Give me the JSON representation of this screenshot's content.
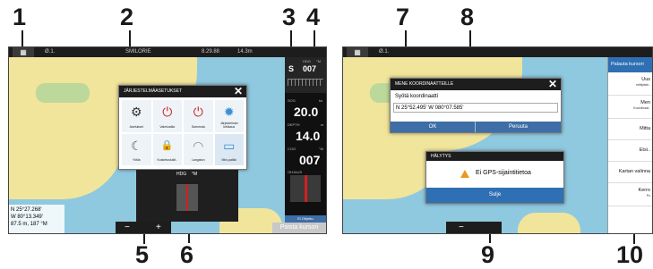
{
  "callouts": [
    "1",
    "2",
    "3",
    "4",
    "5",
    "6",
    "7",
    "8",
    "9",
    "10"
  ],
  "left_screen": {
    "topbar_text": [
      "Ø.1.",
      "SMILORIE",
      "8.29.88",
      "14.3m"
    ],
    "coords": [
      "N 25°27.268'",
      "W 80°13.349'",
      "87.5 m, 187 °M"
    ],
    "zoom": {
      "minus": "−",
      "plus": "+"
    },
    "settings_dialog": {
      "title": "JÄRJESTELMÄASETUKSET",
      "close": "✕",
      "tiles": [
        {
          "label": "Asetukset",
          "icon": "gear-icon",
          "glyph": "⚙",
          "color": "#333333"
        },
        {
          "label": "Valmiustila",
          "icon": "standby-icon",
          "glyph": "⏻",
          "color": "#cc2222"
        },
        {
          "label": "Sammuta",
          "icon": "power-icon",
          "glyph": "⏻",
          "color": "#cc2222"
        },
        {
          "label": "Järjestelmän kirkkaus",
          "icon": "brightness-icon",
          "glyph": "✹",
          "color": "#3d8fd1"
        },
        {
          "label": "Yötila",
          "icon": "night-mode-icon",
          "glyph": "☾",
          "color": "#555555"
        },
        {
          "label": "Kosketuslukit..",
          "icon": "lock-icon",
          "glyph": "🔒",
          "color": "#555555"
        },
        {
          "label": "Langaton",
          "icon": "wireless-icon",
          "glyph": "◠",
          "color": "#888888"
        },
        {
          "label": "Mini-palkki",
          "icon": "minibar-icon",
          "glyph": "▭",
          "color": "#3d8fd1"
        }
      ]
    },
    "hdg_popup": {
      "label": "HDG",
      "unit": "°M"
    },
    "instruments": {
      "hdg_label": "HDG",
      "hdg_unit": "°M",
      "hdg_dir": "S",
      "hdg_value": "007",
      "sog_label": "SOG",
      "sog_unit": "kn",
      "sog_value": "20.0",
      "depth_label": "DEPTH",
      "depth_unit": "m",
      "depth_value": "14.0",
      "cog_label": "COG",
      "cog_unit": "°M",
      "cog_value": "007",
      "steering_label": "OHJAUS",
      "bottom_btn": "Ei Ohjettu"
    },
    "remove_cursor": "Poista kursori"
  },
  "right_screen": {
    "topbar_text": [
      "Ø.1."
    ],
    "goto_dialog": {
      "title": "MENE KOORDINAATTEILLE",
      "close": "✕",
      "prompt": "Syötä koordinaatti",
      "value": "N 25°52.495'  W 080°07.585'",
      "ok": "OK",
      "cancel": "Peruuta"
    },
    "alarm_dialog": {
      "title": "HÄLYTYS",
      "icon": "warning-icon",
      "message": "Ei GPS-sijaintitietoa",
      "button": "Sulje"
    },
    "zoom": {
      "minus": "−"
    },
    "side_menu": {
      "title": "Palauta kursori",
      "items": [
        {
          "label": "Uus",
          "sub": "reittipiste.."
        },
        {
          "label": "Men",
          "sub": "Koordinaat.."
        },
        {
          "label": "Mitta",
          "sub": ""
        },
        {
          "label": "Etsi..",
          "sub": ""
        },
        {
          "label": "Kartan valinna",
          "sub": ""
        },
        {
          "label": "Kerro",
          "sub": "Po"
        }
      ]
    }
  }
}
